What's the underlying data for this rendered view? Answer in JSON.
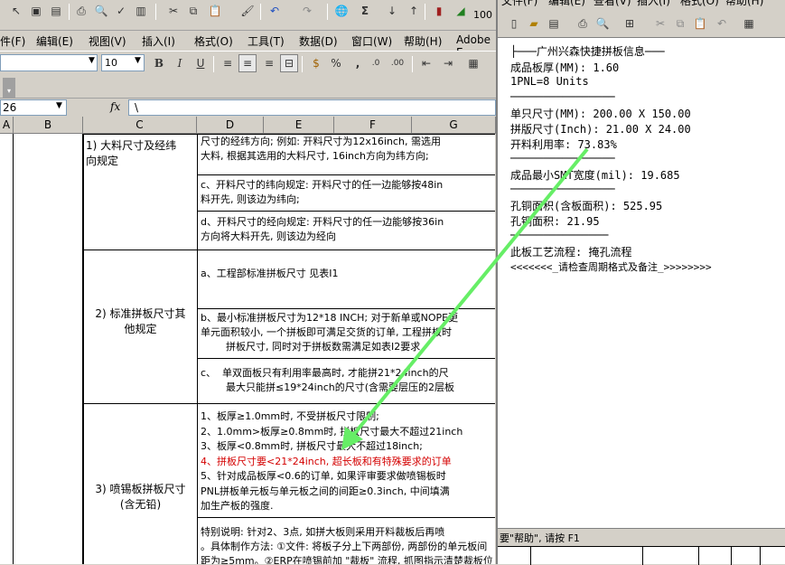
{
  "excel": {
    "title_partial": "",
    "menu": [
      "件(F)",
      "编辑(E)",
      "视图(V)",
      "插入(I)",
      "格式(O)",
      "工具(T)",
      "数据(D)",
      "窗口(W)",
      "帮助(H)",
      "Adobe E"
    ],
    "font_size": "10",
    "zoom": "100",
    "name_box": "26",
    "formula_fx": "fx",
    "formula_value": "\\",
    "columns": [
      "A",
      "B",
      "C",
      "D",
      "E",
      "F",
      "G"
    ],
    "rows": {
      "r1_label": "1) 大料尺寸及经纬\n向规定",
      "r1_text": [
        "尺寸的经纬方向; 例如: 开料尺寸为12x16inch, 需选用",
        "大料, 根据其选用的大料尺寸, 16inch方向为纬方向;"
      ],
      "r1c": [
        "c、开料尺寸的纬向规定: 开料尺寸的任一边能够按48in",
        "料开先, 则该边为纬向;"
      ],
      "r1d": [
        "d、开料尺寸的经向规定: 开料尺寸的任一边能够按36in",
        "方向将大料开先, 则该边为经向"
      ],
      "r2_label": "2) 标准拼板尺寸其\n他规定",
      "r2a": "a、工程部标准拼板尺寸 见表I1",
      "r2b": [
        "b、最小标准拼板尺寸为12*18 INCH; 对于新单或NOPE更",
        "单元面积较小, 一个拼板即可满足交货的订单, 工程拼板时",
        "        拼板尺寸, 同时对于拼板数需满足如表I2要求"
      ],
      "r2c": [
        "c、  单双面板只有利用率最高时, 才能拼21*24inch的尺",
        "        最大只能拼≤19*24inch的尺寸(含需要层压的2层板"
      ],
      "r3_label": "3) 喷锡板拼板尺寸\n(含无铅)",
      "r3_lines": [
        "1、板厚≥1.0mm时, 不受拼板尺寸限制;",
        "2、1.0mm>板厚≥0.8mm时, 拼板尺寸最大不超过21inch",
        "3、板厚<0.8mm时, 拼板尺寸最大不超过18inch;",
        "4、拼板尺寸要<21*24inch, 超长板和有特殊要求的订单",
        "5、针对成品板厚<0.6的订单, 如果评审要求做喷锡板时",
        "PNL拼板单元板与单元板之间的间距≥0.3inch, 中间填满",
        "加生产板的强度."
      ],
      "r4_lines": [
        "特别说明: 针对2、3点, 如拼大板则采用开料裁板后再喷",
        "。具体制作方法: ①文件: 将板子分上下两部份, 两部份的单元板间",
        "距为≥5mm。②ERP在喷锡前加 \"裁板\" 流程, 抓图指示清楚裁板位"
      ]
    }
  },
  "notepad": {
    "menu": [
      "文件(F)",
      "编辑(E)",
      "查看(V)",
      "插入(I)",
      "格式(O)",
      "帮助(H)"
    ],
    "lines": [
      "├───广州兴森快捷拼板信息───",
      "成品板厚(MM): 1.60",
      "1PNL=8 Units",
      "────────────────",
      "单只尺寸(MM): 200.00 X 150.00",
      "拼版尺寸(Inch): 21.00 X 24.00",
      "开料利用率: 73.83%",
      "────────────────",
      "成品最小SMT宽度(mil): 19.685",
      "────────────────",
      "孔铜面积(含板面积): 525.95",
      "孔铜面积: 21.95",
      "───────────────",
      "此板工艺流程: 掩孔流程",
      "<<<<<<<_请检查周期格式及备注_>>>>>>>>"
    ],
    "status": "要\"帮助\", 请按 F1"
  },
  "colors": {
    "arrow": "#66ee66",
    "red_text": "#d40000"
  }
}
